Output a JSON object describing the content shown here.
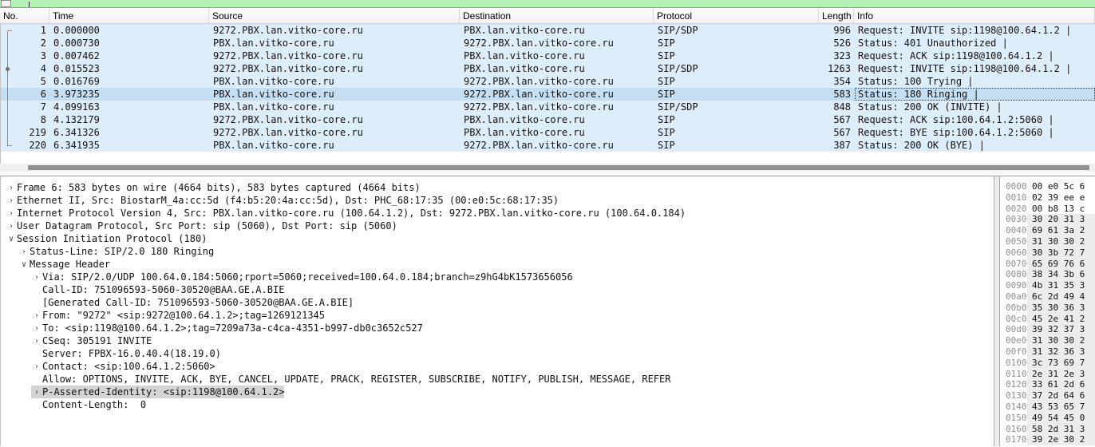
{
  "filter_bar": {
    "bookmark_icon": "bookmark-icon",
    "background_color": "#b5f1b5"
  },
  "packet_list": {
    "columns": [
      {
        "key": "no",
        "label": "No."
      },
      {
        "key": "time",
        "label": "Time"
      },
      {
        "key": "src",
        "label": "Source"
      },
      {
        "key": "dst",
        "label": "Destination"
      },
      {
        "key": "proto",
        "label": "Protocol"
      },
      {
        "key": "len",
        "label": "Length"
      },
      {
        "key": "info",
        "label": "Info"
      }
    ],
    "rows": [
      {
        "no": "1",
        "time": "0.000000",
        "src": "9272.PBX.lan.vitko-core.ru",
        "dst": "PBX.lan.vitko-core.ru",
        "proto": "SIP/SDP",
        "len": "996",
        "info": "Request: INVITE sip:1198@100.64.1.2 |",
        "selected": false
      },
      {
        "no": "2",
        "time": "0.000730",
        "src": "PBX.lan.vitko-core.ru",
        "dst": "9272.PBX.lan.vitko-core.ru",
        "proto": "SIP",
        "len": "526",
        "info": "Status: 401 Unauthorized |",
        "selected": false
      },
      {
        "no": "3",
        "time": "0.007462",
        "src": "9272.PBX.lan.vitko-core.ru",
        "dst": "PBX.lan.vitko-core.ru",
        "proto": "SIP",
        "len": "323",
        "info": "Request: ACK sip:1198@100.64.1.2 |",
        "selected": false
      },
      {
        "no": "4",
        "time": "0.015523",
        "src": "9272.PBX.lan.vitko-core.ru",
        "dst": "PBX.lan.vitko-core.ru",
        "proto": "SIP/SDP",
        "len": "1263",
        "info": "Request: INVITE sip:1198@100.64.1.2 |",
        "selected": false
      },
      {
        "no": "5",
        "time": "0.016769",
        "src": "PBX.lan.vitko-core.ru",
        "dst": "9272.PBX.lan.vitko-core.ru",
        "proto": "SIP",
        "len": "354",
        "info": "Status: 100 Trying |",
        "selected": false
      },
      {
        "no": "6",
        "time": "3.973235",
        "src": "PBX.lan.vitko-core.ru",
        "dst": "9272.PBX.lan.vitko-core.ru",
        "proto": "SIP",
        "len": "583",
        "info": "Status: 180 Ringing |",
        "selected": true
      },
      {
        "no": "7",
        "time": "4.099163",
        "src": "PBX.lan.vitko-core.ru",
        "dst": "9272.PBX.lan.vitko-core.ru",
        "proto": "SIP/SDP",
        "len": "848",
        "info": "Status: 200 OK (INVITE) |",
        "selected": false
      },
      {
        "no": "8",
        "time": "4.132179",
        "src": "9272.PBX.lan.vitko-core.ru",
        "dst": "PBX.lan.vitko-core.ru",
        "proto": "SIP",
        "len": "567",
        "info": "Request: ACK sip:100.64.1.2:5060 |",
        "selected": false
      },
      {
        "no": "219",
        "time": "6.341326",
        "src": "9272.PBX.lan.vitko-core.ru",
        "dst": "PBX.lan.vitko-core.ru",
        "proto": "SIP",
        "len": "567",
        "info": "Request: BYE sip:100.64.1.2:5060 |",
        "selected": false
      },
      {
        "no": "220",
        "time": "6.341935",
        "src": "PBX.lan.vitko-core.ru",
        "dst": "9272.PBX.lan.vitko-core.ru",
        "proto": "SIP",
        "len": "387",
        "info": "Status: 200 OK (BYE) |",
        "selected": false
      }
    ],
    "row_background": "#deedfa",
    "selected_row_background": "#c5def2"
  },
  "packet_details": {
    "lines": [
      {
        "indent": 0,
        "expander": "collapsed",
        "text": "Frame 6: 583 bytes on wire (4664 bits), 583 bytes captured (4664 bits)",
        "selected": false
      },
      {
        "indent": 0,
        "expander": "collapsed",
        "text": "Ethernet II, Src: BiostarM_4a:cc:5d (f4:b5:20:4a:cc:5d), Dst: PHC_68:17:35 (00:e0:5c:68:17:35)",
        "selected": false
      },
      {
        "indent": 0,
        "expander": "collapsed",
        "text": "Internet Protocol Version 4, Src: PBX.lan.vitko-core.ru (100.64.1.2), Dst: 9272.PBX.lan.vitko-core.ru (100.64.0.184)",
        "selected": false
      },
      {
        "indent": 0,
        "expander": "collapsed",
        "text": "User Datagram Protocol, Src Port: sip (5060), Dst Port: sip (5060)",
        "selected": false
      },
      {
        "indent": 0,
        "expander": "expanded",
        "text": "Session Initiation Protocol (180)",
        "selected": false
      },
      {
        "indent": 1,
        "expander": "collapsed",
        "text": "Status-Line: SIP/2.0 180 Ringing",
        "selected": false
      },
      {
        "indent": 1,
        "expander": "expanded",
        "text": "Message Header",
        "selected": false
      },
      {
        "indent": 2,
        "expander": "collapsed",
        "text": "Via: SIP/2.0/UDP 100.64.0.184:5060;rport=5060;received=100.64.0.184;branch=z9hG4bK1573656056",
        "selected": false
      },
      {
        "indent": 2,
        "expander": "none",
        "text": "Call-ID: 751096593-5060-30520@BAA.GE.A.BIE",
        "selected": false
      },
      {
        "indent": 2,
        "expander": "none",
        "text": "[Generated Call-ID: 751096593-5060-30520@BAA.GE.A.BIE]",
        "selected": false
      },
      {
        "indent": 2,
        "expander": "collapsed",
        "text": "From: \"9272\" <sip:9272@100.64.1.2>;tag=1269121345",
        "selected": false
      },
      {
        "indent": 2,
        "expander": "collapsed",
        "text": "To: <sip:1198@100.64.1.2>;tag=7209a73a-c4ca-4351-b997-db0c3652c527",
        "selected": false
      },
      {
        "indent": 2,
        "expander": "collapsed",
        "text": "CSeq: 305191 INVITE",
        "selected": false
      },
      {
        "indent": 2,
        "expander": "none",
        "text": "Server: FPBX-16.0.40.4(18.19.0)",
        "selected": false
      },
      {
        "indent": 2,
        "expander": "collapsed",
        "text": "Contact: <sip:100.64.1.2:5060>",
        "selected": false
      },
      {
        "indent": 2,
        "expander": "none",
        "text": "Allow: OPTIONS, INVITE, ACK, BYE, CANCEL, UPDATE, PRACK, REGISTER, SUBSCRIBE, NOTIFY, PUBLISH, MESSAGE, REFER",
        "selected": false
      },
      {
        "indent": 2,
        "expander": "collapsed",
        "text": "P-Asserted-Identity: <sip:1198@100.64.1.2>",
        "selected": true
      },
      {
        "indent": 2,
        "expander": "none",
        "text": "Content-Length:  0",
        "selected": false
      }
    ],
    "selected_line_background": "#d4d4d4"
  },
  "hex_view": {
    "rows": [
      {
        "offset": "0000",
        "bytes": "00 e0 5c 6",
        "shaded": false
      },
      {
        "offset": "0010",
        "bytes": "02 39 ee e",
        "shaded": false
      },
      {
        "offset": "0020",
        "bytes": "00 b8 13 c",
        "shaded": false
      },
      {
        "offset": "0030",
        "bytes": "30 20 31 3",
        "shaded": true
      },
      {
        "offset": "0040",
        "bytes": "69 61 3a 2",
        "shaded": true
      },
      {
        "offset": "0050",
        "bytes": "31 30 30 2",
        "shaded": true
      },
      {
        "offset": "0060",
        "bytes": "30 3b 72 7",
        "shaded": true
      },
      {
        "offset": "0070",
        "bytes": "65 69 76 6",
        "shaded": true
      },
      {
        "offset": "0080",
        "bytes": "38 34 3b 6",
        "shaded": true
      },
      {
        "offset": "0090",
        "bytes": "4b 31 35 3",
        "shaded": true
      },
      {
        "offset": "00a0",
        "bytes": "6c 2d 49 4",
        "shaded": true
      },
      {
        "offset": "00b0",
        "bytes": "35 30 36 3",
        "shaded": true
      },
      {
        "offset": "00c0",
        "bytes": "45 2e 41 2",
        "shaded": true
      },
      {
        "offset": "00d0",
        "bytes": "39 32 37 3",
        "shaded": true
      },
      {
        "offset": "00e0",
        "bytes": "31 30 30 2",
        "shaded": true
      },
      {
        "offset": "00f0",
        "bytes": "31 32 36 3",
        "shaded": true
      },
      {
        "offset": "0100",
        "bytes": "3c 73 69 7",
        "shaded": true
      },
      {
        "offset": "0110",
        "bytes": "2e 31 2e 3",
        "shaded": true
      },
      {
        "offset": "0120",
        "bytes": "33 61 2d 6",
        "shaded": true
      },
      {
        "offset": "0130",
        "bytes": "37 2d 64 6",
        "shaded": true
      },
      {
        "offset": "0140",
        "bytes": "43 53 65 7",
        "shaded": true
      },
      {
        "offset": "0150",
        "bytes": "49 54 45 0",
        "shaded": true
      },
      {
        "offset": "0160",
        "bytes": "58 2d 31 3",
        "shaded": true
      },
      {
        "offset": "0170",
        "bytes": "39 2e 30 2",
        "shaded": true
      }
    ],
    "shaded_background": "#ececec"
  },
  "glyphs": {
    "collapsed": "›",
    "expanded": "∨"
  }
}
